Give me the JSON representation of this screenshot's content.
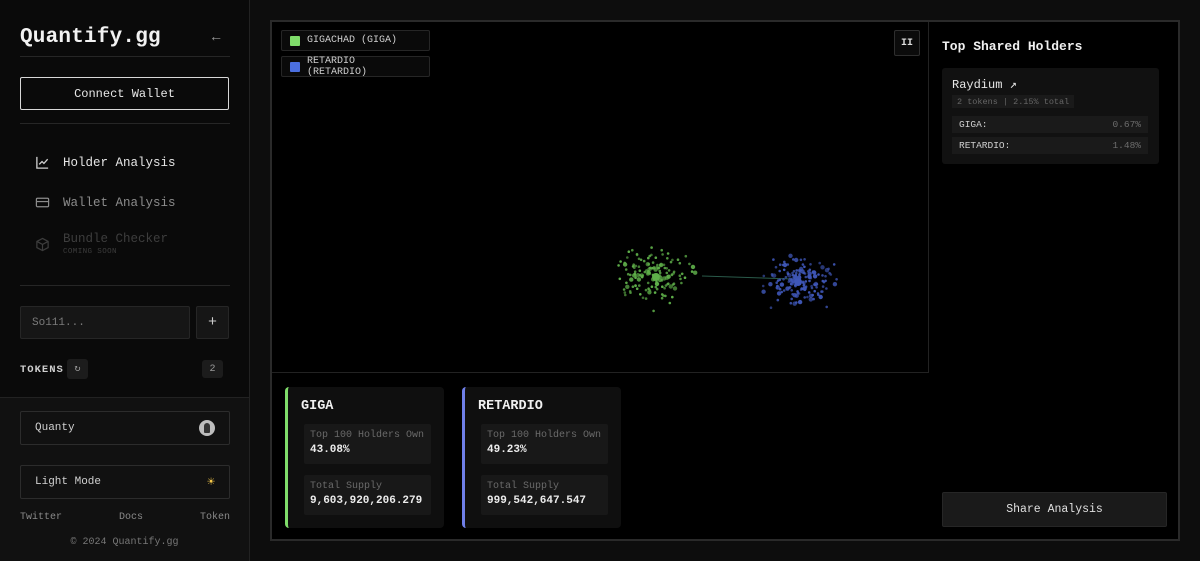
{
  "sidebar": {
    "brand": "Quantify.gg",
    "collapse_glyph": "←",
    "connect_label": "Connect Wallet",
    "nav": [
      {
        "label": "Holder Analysis",
        "icon": "chart-line-icon",
        "state": "active"
      },
      {
        "label": "Wallet Analysis",
        "icon": "wallet-card-icon",
        "state": "normal"
      },
      {
        "label": "Bundle Checker",
        "icon": "cube-icon",
        "state": "disabled",
        "badge": "COMING SOON"
      }
    ],
    "address_placeholder": "So111...",
    "add_glyph": "+",
    "tokens_label": "TOKENS",
    "refresh_glyph": "↻",
    "token_count": "2",
    "user_label": "Quanty",
    "theme_label": "Light Mode",
    "theme_icon": "sun-icon",
    "links": [
      "Twitter",
      "Docs",
      "Token"
    ],
    "copyright": "© 2024 Quantify.gg"
  },
  "graph": {
    "legend": [
      {
        "label": "GIGACHAD (GIGA)",
        "color": "#7fdc6a"
      },
      {
        "label": "RETARDIO (RETARDIO)",
        "color": "#4b6fe0"
      }
    ],
    "pause_glyph": "II",
    "cluster_colors": {
      "giga": "#5fb04a",
      "retardio": "#3f57b8"
    }
  },
  "stats": [
    {
      "title": "GIGA",
      "accent": "#7fdc6a",
      "holders_label": "Top 100 Holders Own",
      "holders_value": "43.08%",
      "supply_label": "Total Supply",
      "supply_value": "9,603,920,206.279"
    },
    {
      "title": "RETARDIO",
      "accent": "#6f7fe8",
      "holders_label": "Top 100 Holders Own",
      "holders_value": "49.23%",
      "supply_label": "Total Supply",
      "supply_value": "999,542,647.547"
    }
  ],
  "holders": {
    "title": "Top Shared Holders",
    "items": [
      {
        "name": "Raydium ↗",
        "summary": "2 tokens | 2.15% total",
        "rows": [
          {
            "k": "GIGA:",
            "v": "0.67%"
          },
          {
            "k": "RETARDIO:",
            "v": "1.48%"
          }
        ]
      }
    ],
    "share_label": "Share Analysis"
  }
}
